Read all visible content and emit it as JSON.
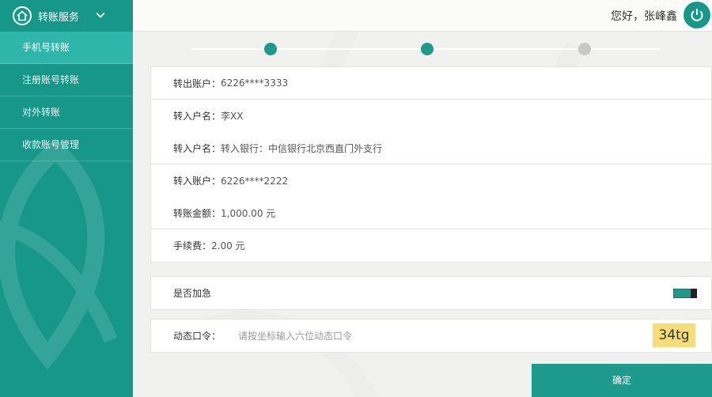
{
  "sidebar": {
    "title": "转账服务",
    "items": [
      {
        "label": "手机号转账",
        "active": true
      },
      {
        "label": "注册账号转账",
        "active": false
      },
      {
        "label": "对外转账",
        "active": false
      },
      {
        "label": "收款账号管理",
        "active": false
      }
    ]
  },
  "header": {
    "greeting": "您好，张峰鑫"
  },
  "steps": {
    "current": 2,
    "total": 3
  },
  "details": {
    "from_account": {
      "label": "转出账户：",
      "value": "6226****3333"
    },
    "payee_name": {
      "label": "转入户名：",
      "value": "李XX"
    },
    "payee_bank": {
      "label": "转入户名：",
      "value": "转入银行：中信银行北京西直门外支行"
    },
    "to_account": {
      "label": "转入账户：",
      "value": "6226****2222"
    },
    "amount": {
      "label": "转账金额：",
      "value": "1,000.00 元"
    },
    "fee": {
      "label": "手续费：",
      "value": "2.00 元"
    }
  },
  "urgent": {
    "label": "是否加急",
    "on": true
  },
  "otp": {
    "label": "动态口令：",
    "placeholder": "请按坐标输入六位动态口令",
    "captcha": "34tg"
  },
  "confirm": {
    "label": "确定"
  },
  "colors": {
    "brand": "#17968a",
    "active_menu": "#2fb6aa",
    "captcha_bg": "#f5de7a"
  }
}
